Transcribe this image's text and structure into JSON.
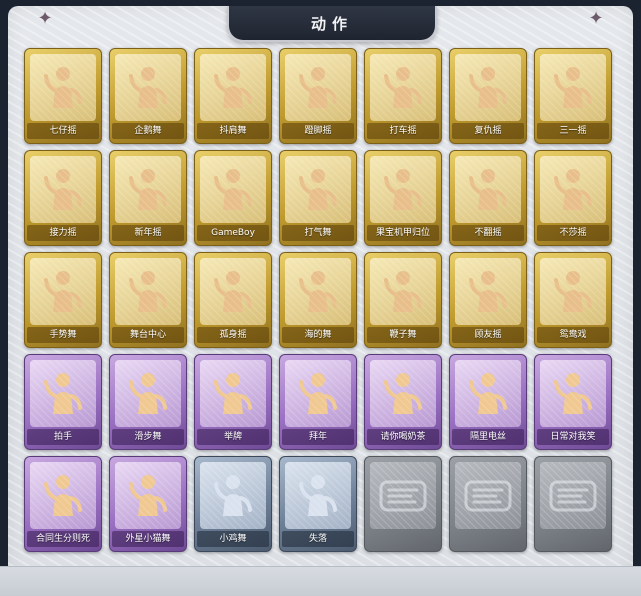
{
  "window": {
    "title": "动作"
  },
  "actions": [
    {
      "label": "七仔摇",
      "tier": "gold",
      "icon": "raise-arm-dance-icon"
    },
    {
      "label": "企鹅舞",
      "tier": "gold",
      "icon": "penguin-dance-icon"
    },
    {
      "label": "抖肩舞",
      "tier": "gold",
      "icon": "shoulder-shake-icon"
    },
    {
      "label": "蹬脚摇",
      "tier": "gold",
      "icon": "stomp-dance-icon"
    },
    {
      "label": "打车摇",
      "tier": "gold",
      "icon": "taxi-dance-icon"
    },
    {
      "label": "复仇摇",
      "tier": "gold",
      "icon": "revenge-dance-icon"
    },
    {
      "label": "三一摇",
      "tier": "gold",
      "icon": "sanyi-dance-icon"
    },
    {
      "label": "接力摇",
      "tier": "gold",
      "icon": "relay-dance-icon"
    },
    {
      "label": "新年摇",
      "tier": "gold",
      "icon": "new-year-dance-icon"
    },
    {
      "label": "GameBoy",
      "tier": "gold",
      "icon": "gameboy-dance-icon"
    },
    {
      "label": "打气舞",
      "tier": "gold",
      "icon": "cheer-dance-icon"
    },
    {
      "label": "果宝机甲归位",
      "tier": "gold",
      "icon": "mecha-pose-icon"
    },
    {
      "label": "不翻摇",
      "tier": "gold",
      "icon": "point-dance-icon"
    },
    {
      "label": "不莎摇",
      "tier": "gold",
      "icon": "arm-up-dance-icon"
    },
    {
      "label": "手势舞",
      "tier": "gold",
      "icon": "hand-gesture-icon"
    },
    {
      "label": "舞台中心",
      "tier": "gold",
      "icon": "center-stage-icon"
    },
    {
      "label": "孤身摇",
      "tier": "gold",
      "icon": "solo-dance-icon"
    },
    {
      "label": "海的舞",
      "tier": "gold",
      "icon": "sea-dance-icon"
    },
    {
      "label": "鞭子舞",
      "tier": "gold",
      "icon": "whip-dance-icon"
    },
    {
      "label": "顾友摇",
      "tier": "gold",
      "icon": "friend-dance-icon"
    },
    {
      "label": "鸳鸯戏",
      "tier": "gold",
      "icon": "duet-dance-icon"
    },
    {
      "label": "拍手",
      "tier": "purple",
      "icon": "clap-icon"
    },
    {
      "label": "滑步舞",
      "tier": "purple",
      "icon": "slide-step-icon"
    },
    {
      "label": "举牌",
      "tier": "purple",
      "icon": "hold-sign-icon"
    },
    {
      "label": "拜年",
      "tier": "purple",
      "icon": "new-year-greeting-icon"
    },
    {
      "label": "请你喝奶茶",
      "tier": "purple",
      "icon": "milk-tea-icon"
    },
    {
      "label": "隔里电丝",
      "tier": "purple",
      "icon": "electric-dance-icon"
    },
    {
      "label": "日常对我笑",
      "tier": "purple",
      "icon": "smile-pose-icon"
    },
    {
      "label": "合同生分则死",
      "tier": "purple",
      "icon": "group-pose-icon"
    },
    {
      "label": "外星小猫舞",
      "tier": "purple",
      "icon": "alien-cat-dance-icon"
    },
    {
      "label": "小鸡舞",
      "tier": "steel",
      "icon": "chicken-dance-icon"
    },
    {
      "label": "失落",
      "tier": "steel",
      "icon": "crawl-icon"
    },
    {
      "label": "",
      "tier": "locked",
      "icon": "locked-logo-icon"
    },
    {
      "label": "",
      "tier": "locked",
      "icon": "locked-logo-icon"
    },
    {
      "label": "",
      "tier": "locked",
      "icon": "locked-logo-icon"
    }
  ]
}
